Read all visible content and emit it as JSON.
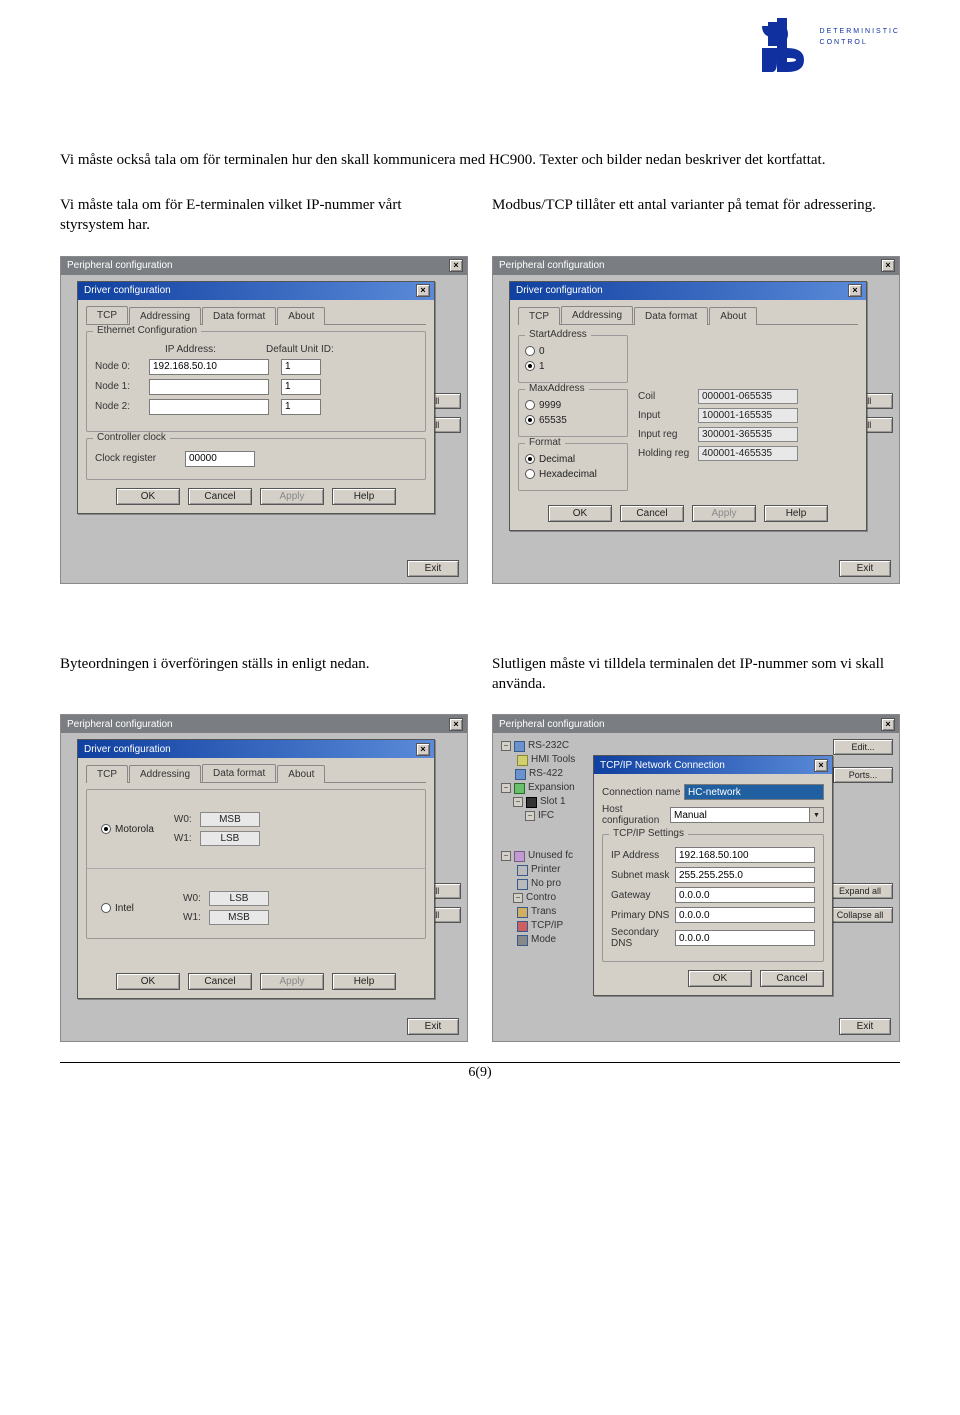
{
  "logo": {
    "line1": "DETERMINISTIC",
    "line2": "CONTROL"
  },
  "intro": "Vi måste också tala om för terminalen hur den skall kommunicera med HC900. Texter och bilder nedan beskriver det kortfattat.",
  "col1a": "Vi måste tala om för E-terminalen vilket IP-nummer vårt styrsystem har.",
  "col2a": "Modbus/TCP tillåter ett antal varianter på temat för adressering.",
  "col1b": "Byteordningen i överföringen ställs in enligt nedan.",
  "col2b": "Slutligen måste vi tilldela terminalen det IP-nummer som vi skall använda.",
  "outer": {
    "title": "Peripheral configuration",
    "exit": "Exit",
    "d_all": "d all",
    "e_all": "e all",
    "edit": "Edit...",
    "ports": "Ports...",
    "expand_all": "Expand all",
    "collapse_all": "Collapse all"
  },
  "driver": {
    "title": "Driver configuration",
    "tab_tcp": "TCP",
    "tab_addressing": "Addressing",
    "tab_dataformat": "Data format",
    "tab_about": "About",
    "ok": "OK",
    "cancel": "Cancel",
    "apply": "Apply",
    "help": "Help"
  },
  "tcp": {
    "group": "Ethernet Configuration",
    "ip_label": "IP Address:",
    "unit_label": "Default Unit ID:",
    "node0": "Node 0:",
    "node1": "Node 1:",
    "node2": "Node 2:",
    "node0_ip": "192.168.50.10",
    "unit_default": "1",
    "clock_group": "Controller clock",
    "clock_label": "Clock register",
    "clock_val": "00000"
  },
  "addressing": {
    "start_group": "StartAddress",
    "start_0": "0",
    "start_1": "1",
    "max_group": "MaxAddress",
    "max_9999": "9999",
    "max_65535": "65535",
    "format_group": "Format",
    "format_dec": "Decimal",
    "format_hex": "Hexadecimal",
    "coil": "Coil",
    "input": "Input",
    "input_reg": "Input reg",
    "holding_reg": "Holding reg",
    "coil_v": "000001-065535",
    "input_v": "100001-165535",
    "input_reg_v": "300001-365535",
    "holding_reg_v": "400001-465535"
  },
  "dataformat": {
    "motorola": "Motorola",
    "intel": "Intel",
    "w0": "W0:",
    "w1": "W1:",
    "msb": "MSB",
    "lsb": "LSB"
  },
  "tree": {
    "rs232c": "RS-232C",
    "hmi_tools": "HMI Tools",
    "rs422": "RS-422",
    "expansion": "Expansion",
    "slot1": "Slot 1",
    "ifc": "IFC",
    "unused": "Unused fc",
    "printer": "Printer",
    "nopr": "No pro",
    "contro": "Contro",
    "trans": "Trans",
    "tcpip": "TCP/IP",
    "mode": "Mode"
  },
  "netconn": {
    "title": "TCP/IP Network Connection",
    "conn_name_label": "Connection name",
    "conn_name": "HC-network",
    "host_conf_label": "Host configuration",
    "host_conf": "Manual",
    "group": "TCP/IP Settings",
    "ip_label": "IP Address",
    "ip": "192.168.50.100",
    "subnet_label": "Subnet mask",
    "subnet": "255.255.255.0",
    "gateway_label": "Gateway",
    "gateway": "0.0.0.0",
    "pdns_label": "Primary DNS",
    "pdns": "0.0.0.0",
    "sdns_label": "Secondary DNS",
    "sdns": "0.0.0.0",
    "ok": "OK",
    "cancel": "Cancel"
  },
  "page_number": "6(9)"
}
